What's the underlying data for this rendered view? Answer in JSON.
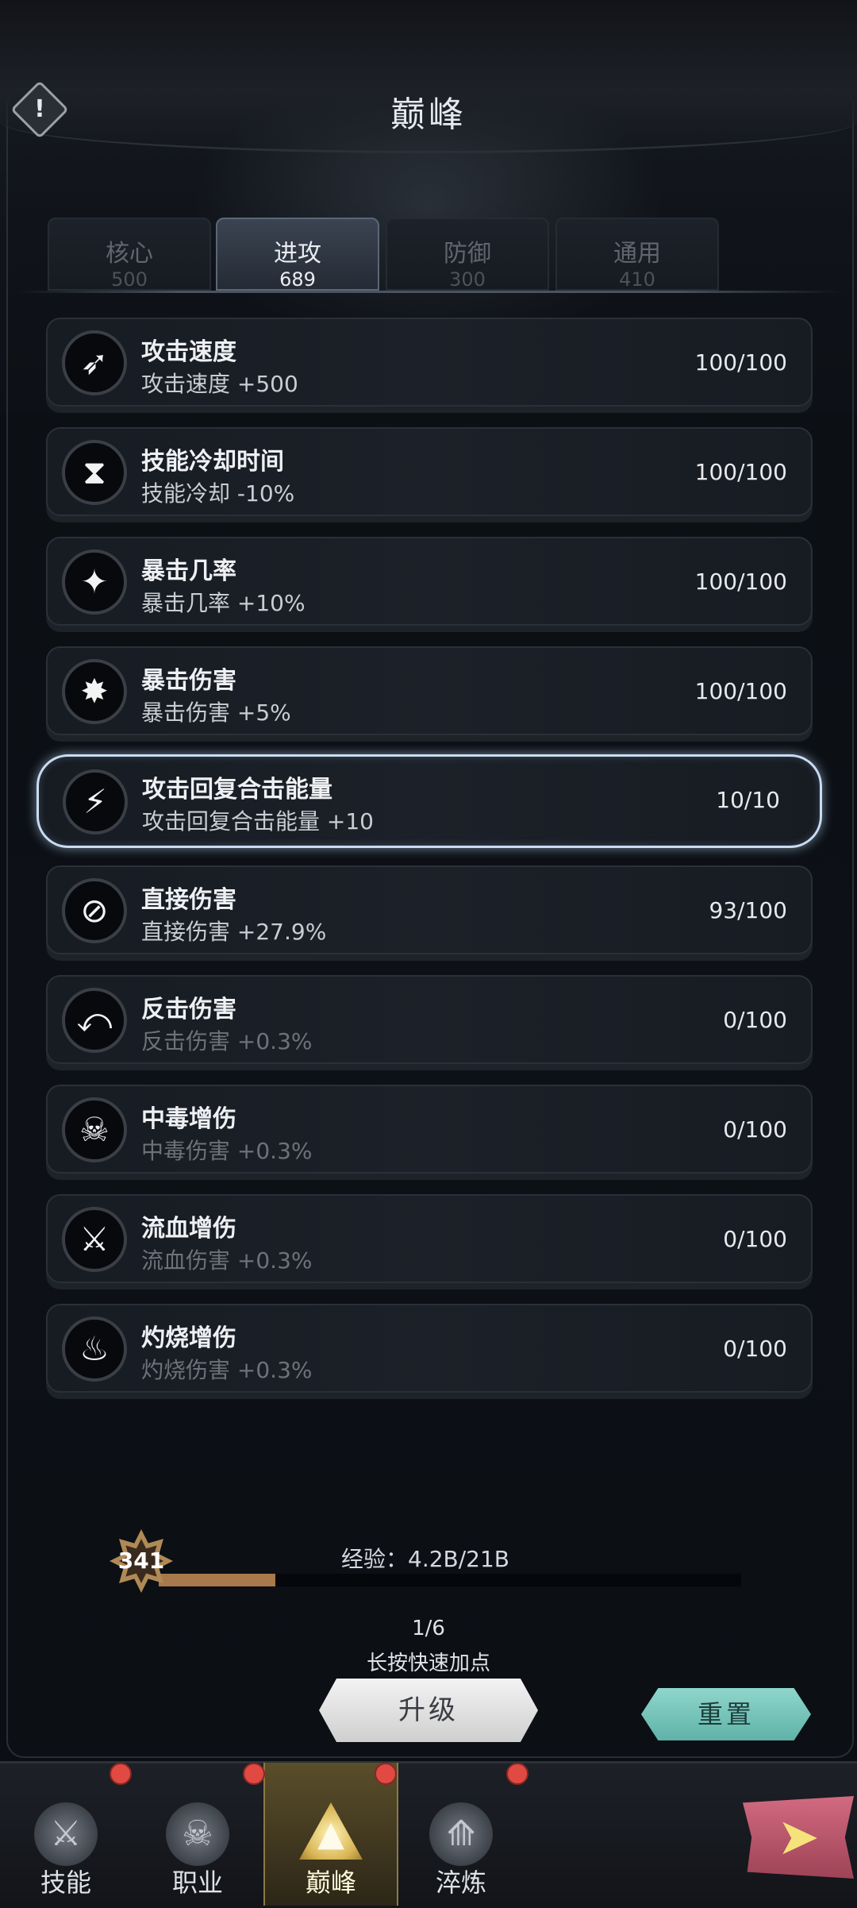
{
  "header": {
    "title": "巅峰",
    "info_icon": "!"
  },
  "tabs": [
    {
      "label": "核心",
      "value": "500"
    },
    {
      "label": "进攻",
      "value": "689"
    },
    {
      "label": "防御",
      "value": "300"
    },
    {
      "label": "通用",
      "value": "410"
    }
  ],
  "rows": [
    {
      "name": "攻击速度",
      "desc": "攻击速度 +500",
      "progress": "100/100",
      "icon": "attack-speed-icon",
      "glyph": "➶"
    },
    {
      "name": "技能冷却时间",
      "desc": "技能冷却 -10%",
      "progress": "100/100",
      "icon": "hourglass-icon",
      "glyph": "⧗"
    },
    {
      "name": "暴击几率",
      "desc": "暴击几率 +10%",
      "progress": "100/100",
      "icon": "crit-chance-icon",
      "glyph": "✦"
    },
    {
      "name": "暴击伤害",
      "desc": "暴击伤害 +5%",
      "progress": "100/100",
      "icon": "crit-damage-icon",
      "glyph": "✸"
    },
    {
      "name": "攻击回复合击能量",
      "desc": "攻击回复合击能量 +10",
      "progress": "10/10",
      "icon": "energy-recovery-icon",
      "glyph": "⚡"
    },
    {
      "name": "直接伤害",
      "desc": "直接伤害 +27.9%",
      "progress": "93/100",
      "icon": "direct-damage-icon",
      "glyph": "⊘"
    },
    {
      "name": "反击伤害",
      "desc": "反击伤害 +0.3%",
      "progress": "0/100",
      "icon": "counterattack-icon",
      "glyph": "⤺"
    },
    {
      "name": "中毒增伤",
      "desc": "中毒伤害 +0.3%",
      "progress": "0/100",
      "icon": "poison-bottle-icon",
      "glyph": "☠"
    },
    {
      "name": "流血增伤",
      "desc": "流血伤害 +0.3%",
      "progress": "0/100",
      "icon": "bleeding-sword-icon",
      "glyph": "⚔"
    },
    {
      "name": "灼烧增伤",
      "desc": "灼烧伤害 +0.3%",
      "progress": "0/100",
      "icon": "fire-icon",
      "glyph": "♨"
    }
  ],
  "level": {
    "value": "341",
    "exp_text": "经验：4.2B/21B",
    "exp_fraction": 0.2
  },
  "pagination": "1/6",
  "hint": "长按快速加点",
  "buttons": {
    "upgrade": "升级",
    "reset": "重置"
  },
  "nav": [
    {
      "label": "技能",
      "icon": "skills-icon",
      "glyph": "⚔"
    },
    {
      "label": "职业",
      "icon": "class-icon",
      "glyph": "☠"
    },
    {
      "label": "巅峰",
      "icon": "peak-icon",
      "glyph": "▲"
    },
    {
      "label": "淬炼",
      "icon": "refine-icon",
      "glyph": "⟰"
    }
  ],
  "next_glyph": "➤",
  "colors": {
    "accent_gold": "#b08a55",
    "reset_teal": "#6fc3b8",
    "selected_outline": "#c9dcf2",
    "notification_red": "#e04a43"
  }
}
